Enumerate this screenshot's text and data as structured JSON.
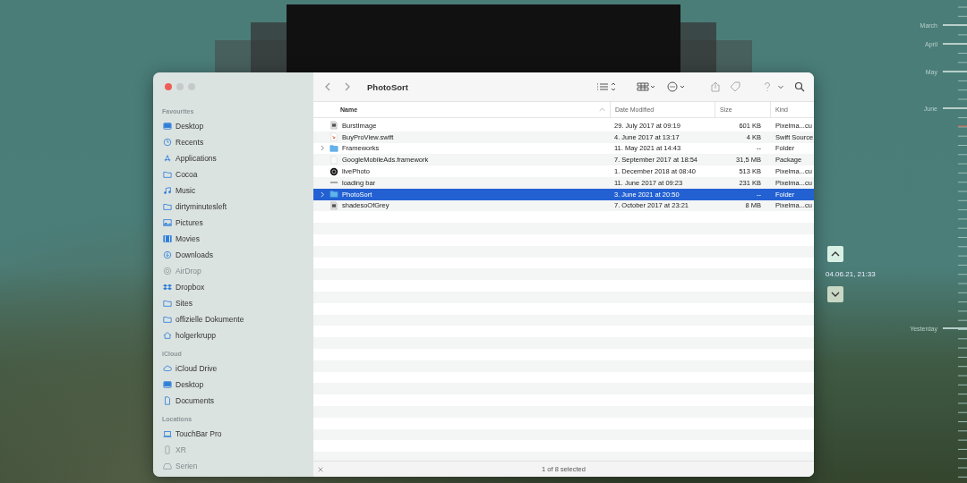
{
  "window": {
    "title": "PhotoSort"
  },
  "sidebar": {
    "sections": [
      {
        "heading": "Favourites",
        "items": [
          {
            "label": "Desktop",
            "kind": "desktop",
            "disabled": false
          },
          {
            "label": "Recents",
            "kind": "clock",
            "disabled": false
          },
          {
            "label": "Applications",
            "kind": "apps",
            "disabled": false
          },
          {
            "label": "Cocoa",
            "kind": "folder",
            "disabled": false
          },
          {
            "label": "Music",
            "kind": "music",
            "disabled": false
          },
          {
            "label": "dirtyminutesleft",
            "kind": "folder",
            "disabled": false
          },
          {
            "label": "Pictures",
            "kind": "pictures",
            "disabled": false
          },
          {
            "label": "Movies",
            "kind": "movies",
            "disabled": false
          },
          {
            "label": "Downloads",
            "kind": "download",
            "disabled": false
          },
          {
            "label": "AirDrop",
            "kind": "airdrop",
            "disabled": true
          },
          {
            "label": "Dropbox",
            "kind": "dropbox",
            "disabled": false
          },
          {
            "label": "Sites",
            "kind": "folder",
            "disabled": false
          },
          {
            "label": "offizielle Dokumente",
            "kind": "folder",
            "disabled": false
          },
          {
            "label": "holgerkrupp",
            "kind": "home",
            "disabled": false
          }
        ]
      },
      {
        "heading": "iCloud",
        "items": [
          {
            "label": "iCloud Drive",
            "kind": "cloud",
            "disabled": false
          },
          {
            "label": "Desktop",
            "kind": "desktop",
            "disabled": false
          },
          {
            "label": "Documents",
            "kind": "document",
            "disabled": false
          }
        ]
      },
      {
        "heading": "Locations",
        "items": [
          {
            "label": "TouchBar Pro",
            "kind": "laptop",
            "disabled": false
          },
          {
            "label": "XR",
            "kind": "phone",
            "disabled": true
          },
          {
            "label": "Serien",
            "kind": "drive",
            "disabled": true
          }
        ]
      }
    ]
  },
  "table": {
    "columns": [
      {
        "label": "Name",
        "sorted": true
      },
      {
        "label": "Date Modified",
        "sorted": false
      },
      {
        "label": "Size",
        "sorted": false
      },
      {
        "label": "Kind",
        "sorted": false
      }
    ],
    "rows": [
      {
        "name": "BurstImage",
        "kind": "image",
        "expandable": false,
        "selected": false,
        "date": "29. July 2017 at 09:19",
        "size": "601 KB",
        "file_type": "Pixelma...cu"
      },
      {
        "name": "BuyProView.swift",
        "kind": "swift",
        "expandable": false,
        "selected": false,
        "date": "4. June 2017 at 13:17",
        "size": "4 KB",
        "file_type": "Swift Source"
      },
      {
        "name": "Frameworks",
        "kind": "folder",
        "expandable": true,
        "selected": false,
        "date": "11. May 2021 at 14:43",
        "size": "--",
        "file_type": "Folder"
      },
      {
        "name": "GoogleMobileAds.framework",
        "kind": "file",
        "expandable": false,
        "selected": false,
        "date": "7. September 2017 at 18:54",
        "size": "31,5 MB",
        "file_type": "Package"
      },
      {
        "name": "livePhoto",
        "kind": "circle",
        "expandable": false,
        "selected": false,
        "date": "1. December 2018 at 08:40",
        "size": "513 KB",
        "file_type": "Pixelma...cu"
      },
      {
        "name": "loading bar",
        "kind": "bar",
        "expandable": false,
        "selected": false,
        "date": "11. June 2017 at 09:23",
        "size": "231 KB",
        "file_type": "Pixelma...cu"
      },
      {
        "name": "PhotoSort",
        "kind": "folder",
        "expandable": true,
        "selected": true,
        "date": "3. June 2021 at 20:50",
        "size": "--",
        "file_type": "Folder"
      },
      {
        "name": "shadesoOfGrey",
        "kind": "image",
        "expandable": false,
        "selected": false,
        "date": "7. October 2017 at 23:21",
        "size": "8 MB",
        "file_type": "Pixelma...cu"
      }
    ]
  },
  "status_bar": {
    "text": "1 of 8 selected"
  },
  "time_machine": {
    "date": "04.06.21, 21:33"
  },
  "timeline": {
    "labels": [
      "March",
      "April",
      "May",
      "June",
      "Yesterday"
    ]
  }
}
